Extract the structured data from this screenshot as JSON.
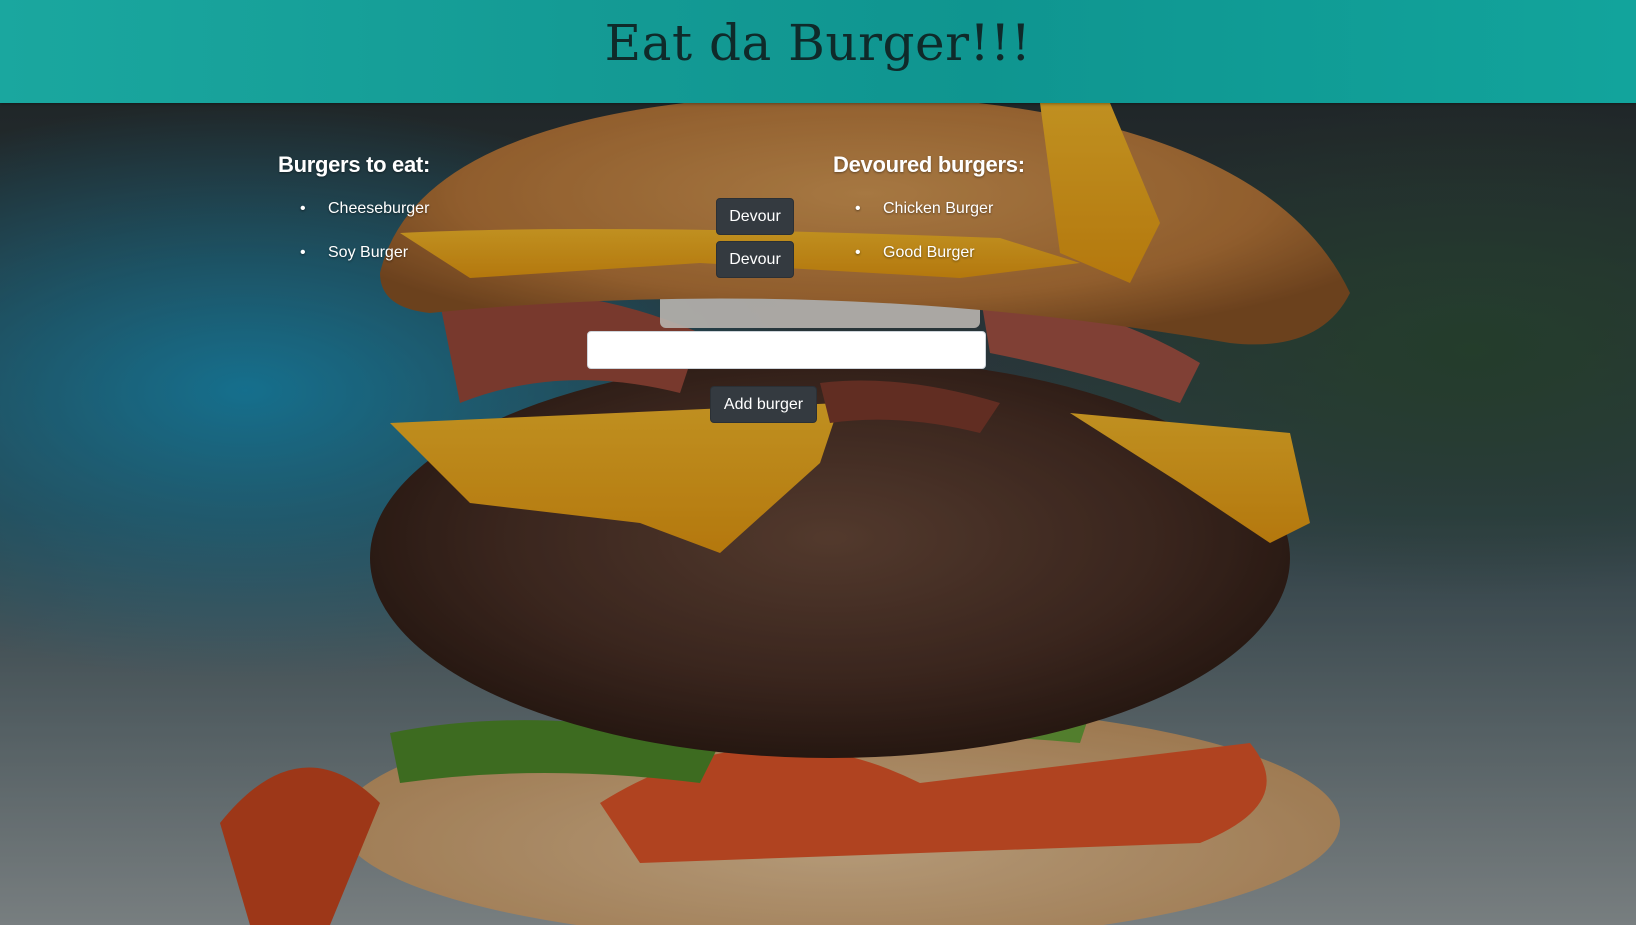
{
  "header": {
    "title": "Eat da Burger!!!",
    "background_color": "#15a19a",
    "title_color": "#0f2a2a"
  },
  "to_eat": {
    "title": "Burgers to eat:",
    "items": [
      {
        "name": "Cheeseburger",
        "button_label": "Devour"
      },
      {
        "name": "Soy Burger",
        "button_label": "Devour"
      }
    ]
  },
  "devoured": {
    "title": "Devoured burgers:",
    "items": [
      {
        "name": "Chicken Burger"
      },
      {
        "name": "Good Burger"
      }
    ]
  },
  "add_form": {
    "input_value": "",
    "input_placeholder": "",
    "submit_label": "Add burger"
  },
  "colors": {
    "button_background": "#343a40",
    "text": "#ffffff"
  }
}
